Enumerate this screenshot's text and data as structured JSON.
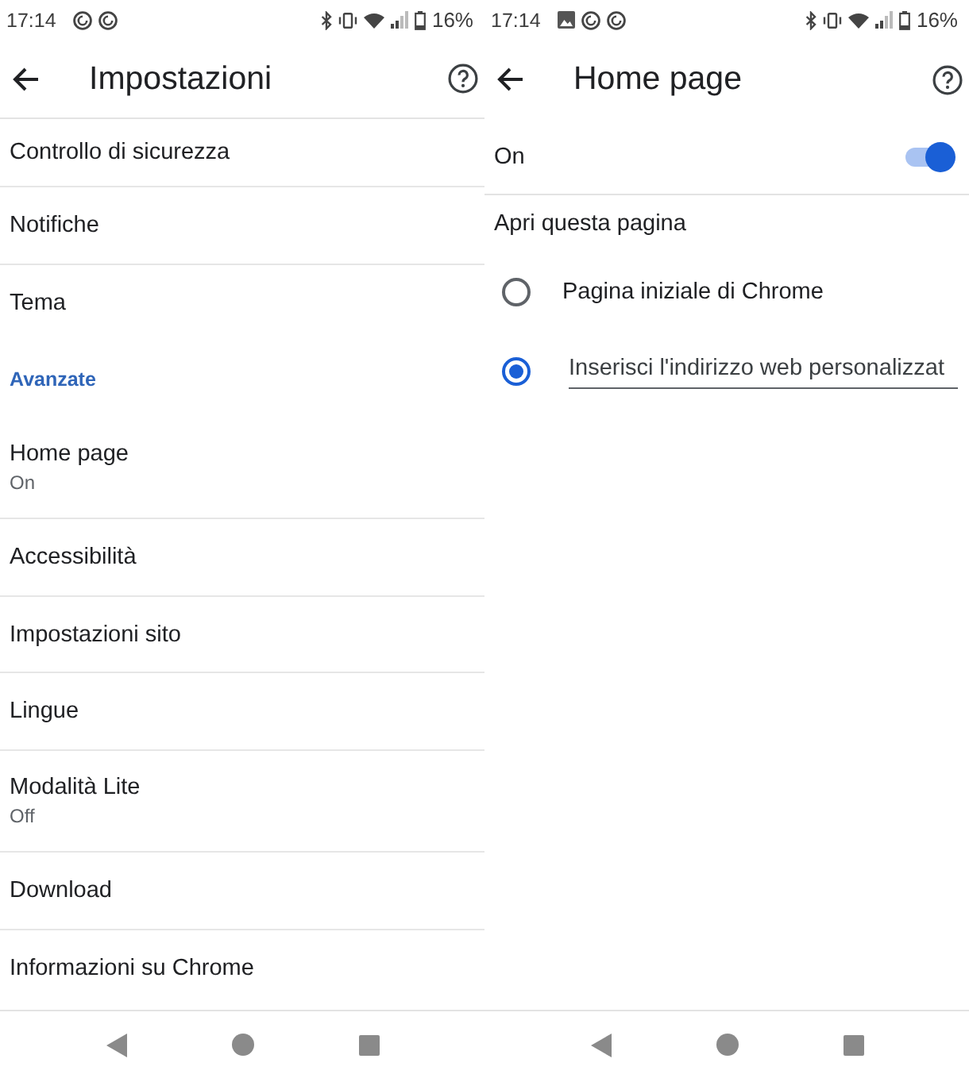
{
  "screens": [
    {
      "kind": "settings",
      "status_bar": {
        "time": "17:14",
        "notifications": [
          {
            "kind": "app"
          },
          {
            "kind": "app"
          }
        ],
        "battery": "16%"
      },
      "title": "Impostazioni",
      "items": [
        {
          "kind": "item",
          "label": "Controllo di sicurezza"
        },
        {
          "kind": "item",
          "label": "Notifiche"
        },
        {
          "kind": "item",
          "label": "Tema"
        },
        {
          "kind": "section",
          "label": "Avanzate"
        },
        {
          "kind": "item",
          "label": "Home page",
          "summary": "On"
        },
        {
          "kind": "item",
          "label": "Accessibilità"
        },
        {
          "kind": "item",
          "label": "Impostazioni sito"
        },
        {
          "kind": "item",
          "label": "Lingue"
        },
        {
          "kind": "item",
          "label": "Modalità Lite",
          "summary": "Off"
        },
        {
          "kind": "item",
          "label": "Download"
        },
        {
          "kind": "item",
          "label": "Informazioni su Chrome"
        }
      ]
    },
    {
      "kind": "detail",
      "status_bar": {
        "time": "17:14",
        "notifications": [
          {
            "kind": "image"
          },
          {
            "kind": "app"
          },
          {
            "kind": "app"
          }
        ],
        "battery": "16%"
      },
      "title": "Home page",
      "toggle": {
        "label": "On",
        "on": true
      },
      "section": "Apri questa pagina",
      "options": [
        {
          "kind": "label",
          "label": "Pagina iniziale di Chrome",
          "selected": false
        },
        {
          "kind": "field",
          "placeholder": "Inserisci l'indirizzo web personalizzat",
          "selected": true
        }
      ]
    }
  ]
}
